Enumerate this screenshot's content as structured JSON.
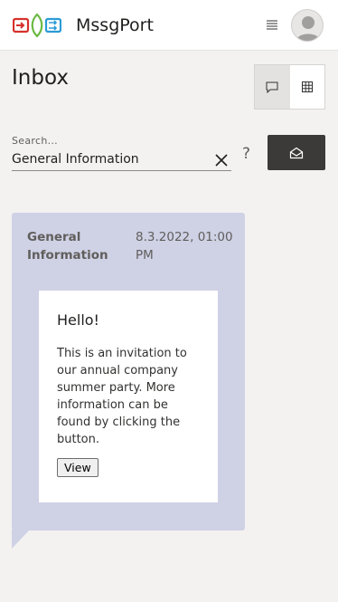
{
  "app": {
    "title": "MssgPort"
  },
  "header": {
    "menu_icon": "hamburger-icon",
    "avatar_icon": "user-avatar-icon"
  },
  "page": {
    "title": "Inbox"
  },
  "view_toggle": {
    "items": [
      {
        "icon": "chat-bubble-icon",
        "active": true
      },
      {
        "icon": "grid-icon",
        "active": false
      }
    ]
  },
  "search": {
    "label": "Search...",
    "value": "General Information",
    "clear_icon": "close-icon",
    "help": "?",
    "action_icon": "open-envelope-icon"
  },
  "message": {
    "sender": "General Information",
    "timestamp": "8.3.2022, 01:00 PM",
    "greeting": "Hello!",
    "body": "This is an invitation to our annual company summer party. More information can be found by clicking the button.",
    "button_label": "View"
  },
  "colors": {
    "header_bg": "#ffffff",
    "page_bg": "#f3f2f1",
    "message_bg": "#cfd1e5",
    "dark_button": "#3b3a39",
    "logo_red": "#d6312b",
    "logo_green": "#6bb944",
    "logo_blue": "#2b9bd6"
  }
}
